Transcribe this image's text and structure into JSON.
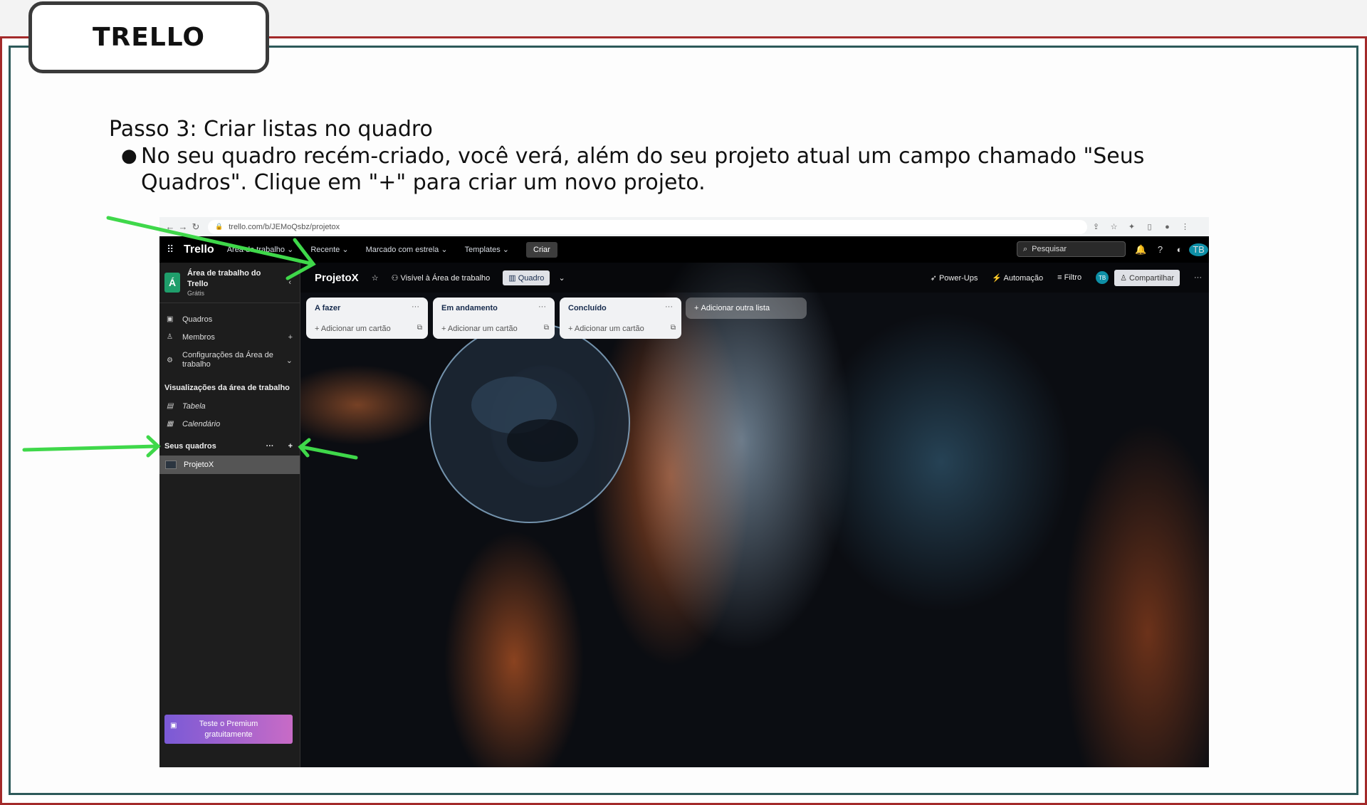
{
  "slide": {
    "title": "TRELLO",
    "step_title": "Passo 3: Criar listas no quadro",
    "bullet": "No seu quadro recém-criado, você verá, além do seu projeto atual um campo chamado \"Seus Quadros\". Clique em \"+\" para criar um novo projeto."
  },
  "browser": {
    "url": "trello.com/b/JEMoQsbz/projetox"
  },
  "topbar": {
    "logo": "Trello",
    "menus": [
      "Área de trabalho",
      "Recente",
      "Marcado com estrela",
      "Templates"
    ],
    "create": "Criar",
    "search_placeholder": "Pesquisar",
    "avatar": "TB"
  },
  "sidebar": {
    "workspace_badge": "Á",
    "workspace_name_line1": "Área de trabalho do",
    "workspace_name_line2": "Trello",
    "workspace_plan": "Grátis",
    "nav": [
      "Quadros",
      "Membros"
    ],
    "settings_line1": "Configurações da Área de",
    "settings_line2": "trabalho",
    "views_heading": "Visualizações da área de trabalho",
    "views": [
      "Tabela",
      "Calendário"
    ],
    "boards_heading": "Seus quadros",
    "boards": [
      "ProjetoX"
    ],
    "premium_line1": "Teste o Premium",
    "premium_line2": "gratuitamente"
  },
  "board": {
    "name": "ProjetoX",
    "visibility": "Visível à Área de trabalho",
    "view": "Quadro",
    "power_ups": "Power-Ups",
    "automation": "Automação",
    "filter": "Filtro",
    "share": "Compartilhar",
    "lists": [
      {
        "title": "A fazer",
        "add_card": "Adicionar um cartão"
      },
      {
        "title": "Em andamento",
        "add_card": "Adicionar um cartão"
      },
      {
        "title": "Concluído",
        "add_card": "Adicionar um cartão"
      }
    ],
    "add_list": "Adicionar outra lista"
  },
  "colors": {
    "frame_outer": "#a32a2a",
    "frame_inner": "#2d5a5a",
    "arrow": "#3fd84a",
    "workspace_badge": "#1f9e6b"
  }
}
